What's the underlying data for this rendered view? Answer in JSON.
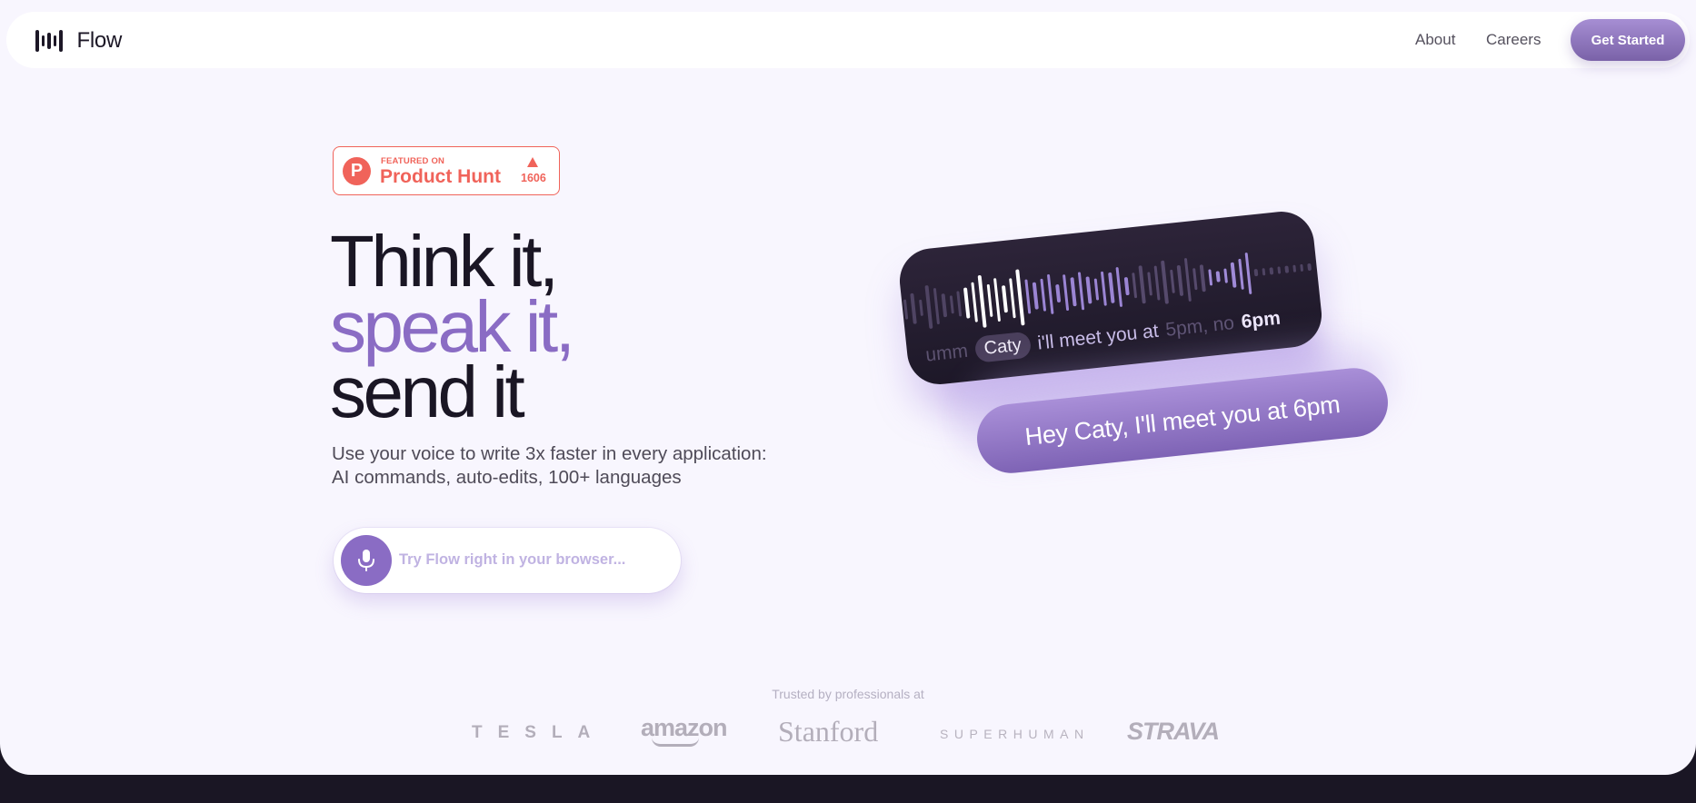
{
  "navbar": {
    "brand": "Flow",
    "links": [
      {
        "label": "About"
      },
      {
        "label": "Careers"
      }
    ],
    "cta_label": "Get Started"
  },
  "product_hunt": {
    "logo_letter": "P",
    "featured_label": "FEATURED ON",
    "name": "Product Hunt",
    "upvotes": "1606"
  },
  "hero": {
    "line1": "Think it,",
    "line2": "speak it,",
    "line3": "send it",
    "subtitle_line1": "Use your voice to write 3x faster in every application:",
    "subtitle_line2": "AI commands, auto-edits, 100+ languages"
  },
  "try_box": {
    "placeholder": "Try Flow right in your browser..."
  },
  "demo": {
    "transcript": {
      "filler": "umm",
      "name_chip": "Caty",
      "main": "i'll meet you at",
      "corrected": "5pm, no",
      "final": "6pm"
    },
    "result": "Hey Caty, I'll meet you at 6pm"
  },
  "trusted": {
    "label": "Trusted by professionals at",
    "companies": [
      "TESLA",
      "amazon",
      "Stanford",
      "SUPERHUMAN",
      "STRAVA"
    ]
  },
  "colors": {
    "accent": "#8a6cc4",
    "product_hunt": "#f0635a",
    "dark": "#1a1624",
    "background": "#f8f6fe"
  }
}
